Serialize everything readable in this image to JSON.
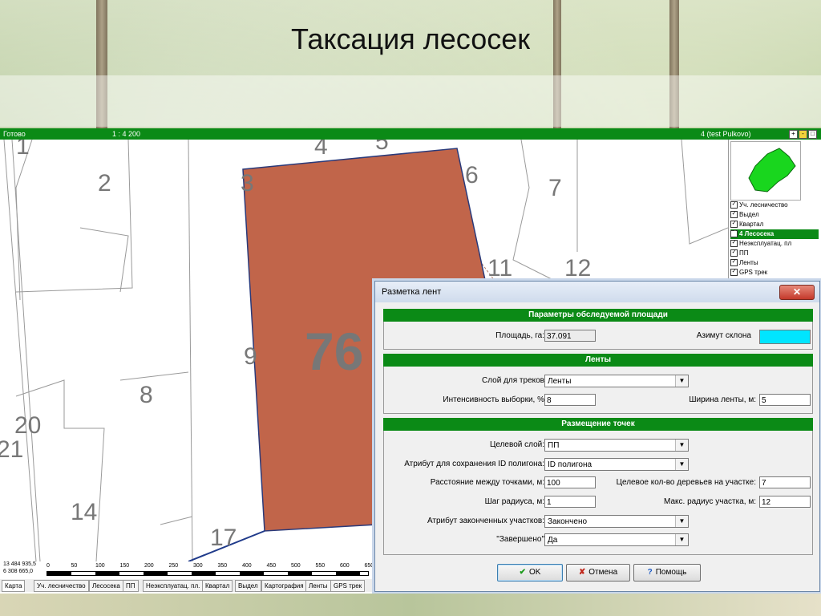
{
  "slide": {
    "title": "Таксация лесосек"
  },
  "app": {
    "status": {
      "left": "Готово",
      "scale": "1 : 4 200",
      "right": "4 (test Pulkovo)"
    },
    "window_buttons": [
      "+",
      "-",
      "□"
    ],
    "map": {
      "plot_numbers": [
        "1",
        "2",
        "3",
        "4",
        "5",
        "6",
        "7",
        "8",
        "9",
        "11",
        "12",
        "14",
        "17",
        "20",
        "21"
      ],
      "big_number": "76"
    },
    "coords": {
      "x": "13 484 935,5",
      "y": "6 308 665,0"
    },
    "scale_ticks": [
      "0",
      "50",
      "100",
      "150",
      "200",
      "250",
      "300",
      "350",
      "400",
      "450",
      "500",
      "550",
      "600",
      "650"
    ],
    "layers": [
      {
        "label": "Уч. лесничество",
        "checked": true
      },
      {
        "label": "Выдел",
        "checked": true
      },
      {
        "label": "Квартал",
        "checked": true
      },
      {
        "label": "4 Лесосека",
        "checked": true,
        "selected": true
      },
      {
        "label": "Неэксплуатац. пл",
        "checked": true
      },
      {
        "label": "ПП",
        "checked": true
      },
      {
        "label": "Ленты",
        "checked": true
      },
      {
        "label": "GPS трек",
        "checked": true
      }
    ],
    "tabs": [
      "Карта",
      "Уч. лесничество",
      "Лесосека",
      "ПП",
      "Неэксплуатац. пл.",
      "Квартал",
      "Выдел",
      "Картография",
      "Ленты",
      "GPS трек"
    ]
  },
  "dialog": {
    "title": "Разметка лент",
    "close": "✕",
    "sections": {
      "area": "Параметры обследуемой площади",
      "strips": "Ленты",
      "points": "Размещение точек"
    },
    "area": {
      "area_label": "Площадь, га:",
      "area_value": "37.091",
      "azimuth_label": "Азимут склона"
    },
    "strips": {
      "track_layer_label": "Слой для треков",
      "track_layer_value": "Ленты",
      "intensity_label": "Интенсивность выборки, %",
      "intensity_value": "8",
      "width_label": "Ширина ленты, м:",
      "width_value": "5"
    },
    "points": {
      "target_layer_label": "Целевой слой:",
      "target_layer_value": "ПП",
      "id_attr_label": "Атрибут для сохранения ID полигона:",
      "id_attr_value": "ID полигона",
      "distance_label": "Расстояние между точками, м:",
      "distance_value": "100",
      "trees_label": "Целевое кол-во деревьев на участке:",
      "trees_value": "7",
      "radius_step_label": "Шаг радиуса, м:",
      "radius_step_value": "1",
      "max_radius_label": "Макс. радиус участка, м:",
      "max_radius_value": "12",
      "done_attr_label": "Атрибут законченных участков:",
      "done_attr_value": "Закончено",
      "done_label": "\"Завершено\"",
      "done_value": "Да"
    },
    "buttons": {
      "ok": "OK",
      "cancel": "Отмена",
      "help": "Помощь"
    }
  },
  "colors": {
    "accent": "#0b8a16",
    "polygon": "#c1654a",
    "azimuth": "#00e5ff"
  }
}
